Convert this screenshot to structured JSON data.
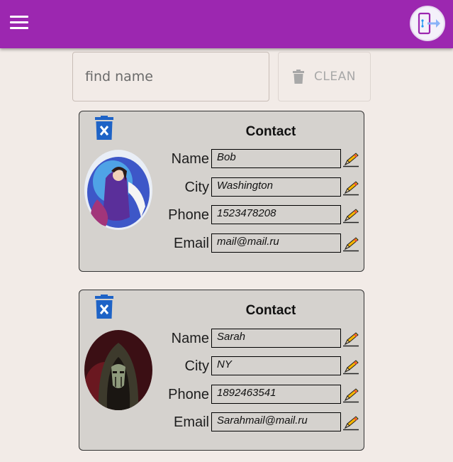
{
  "header": {
    "menu_icon": "hamburger-menu-icon",
    "logout_icon": "logout-door-icon",
    "background_color": "#9c27b0"
  },
  "search": {
    "placeholder": "find name",
    "value": ""
  },
  "clean_button": {
    "label": "CLEAN",
    "icon": "trash-icon",
    "disabled": true
  },
  "contacts": [
    {
      "title": "Contact",
      "avatar": "fantasy-sorceress-portrait",
      "fields": [
        {
          "label": "Name",
          "value": "Bob"
        },
        {
          "label": "City",
          "value": "Washington"
        },
        {
          "label": "Phone",
          "value": "1523478208"
        },
        {
          "label": "Email",
          "value": "mail@mail.ru"
        }
      ]
    },
    {
      "title": "Contact",
      "avatar": "hooded-figure-portrait",
      "fields": [
        {
          "label": "Name",
          "value": "Sarah"
        },
        {
          "label": "City",
          "value": "NY"
        },
        {
          "label": "Phone",
          "value": "1892463541"
        },
        {
          "label": "Email",
          "value": "Sarahmail@mail.ru"
        }
      ]
    }
  ],
  "colors": {
    "accent": "#9c27b0",
    "page_background": "#f2ebe7",
    "card_background": "#d5d2ce",
    "delete_icon": "#1e63c6"
  }
}
